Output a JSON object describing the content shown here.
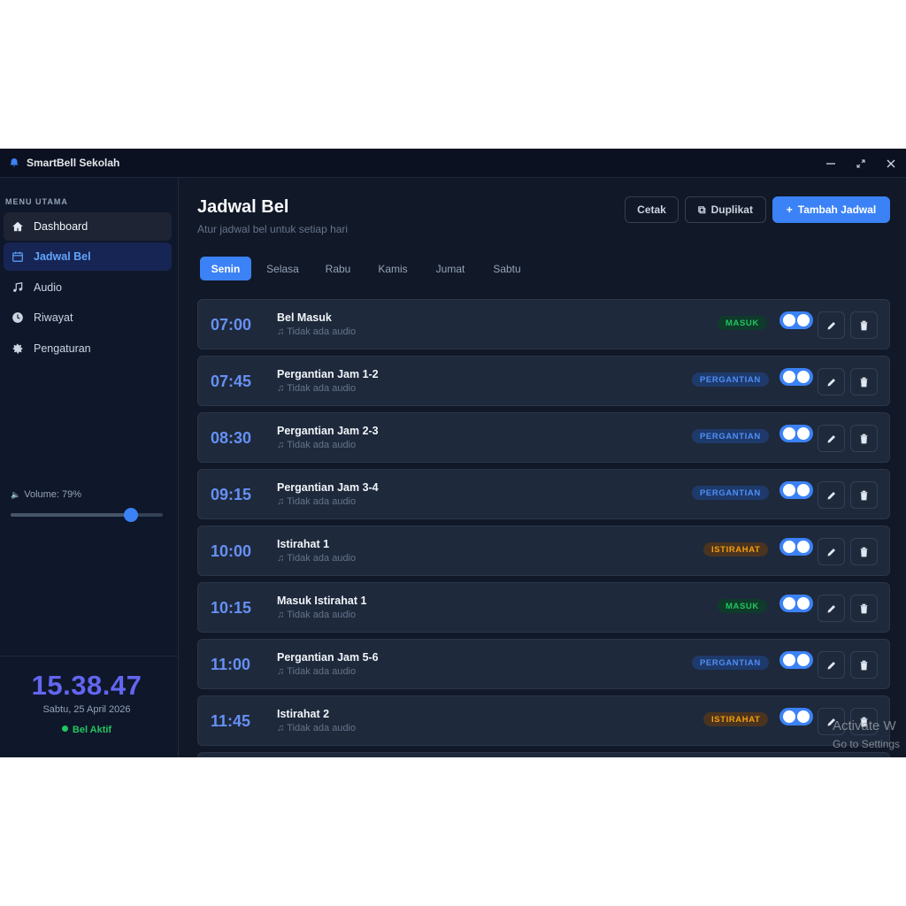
{
  "app": {
    "title": "SmartBell Sekolah"
  },
  "sidebar": {
    "heading": "MENU UTAMA",
    "items": [
      {
        "label": "Dashboard",
        "icon": "home-icon"
      },
      {
        "label": "Jadwal Bel",
        "icon": "calendar-icon"
      },
      {
        "label": "Audio",
        "icon": "music-icon"
      },
      {
        "label": "Riwayat",
        "icon": "clock-icon"
      },
      {
        "label": "Pengaturan",
        "icon": "gear-icon"
      }
    ],
    "volume_label": "Volume: 79%",
    "volume_level": 0.79,
    "clock": "15.38.47",
    "date": "Sabtu, 25 April 2026",
    "status": "Bel Aktif"
  },
  "main": {
    "title": "Jadwal Bel",
    "subtitle": "Atur jadwal bel untuk setiap hari",
    "buttons": {
      "print": "Cetak",
      "duplicate": "Duplikat",
      "add": "Tambah Jadwal"
    },
    "tabs": [
      "Senin",
      "Selasa",
      "Rabu",
      "Kamis",
      "Jumat",
      "Sabtu"
    ],
    "schedule": [
      {
        "time": "07:00",
        "name": "Bel Masuk",
        "audio": "Tidak ada audio",
        "badge": "MASUK",
        "type": "masuk",
        "enabled": true
      },
      {
        "time": "07:45",
        "name": "Pergantian Jam 1-2",
        "audio": "Tidak ada audio",
        "badge": "PERGANTIAN",
        "type": "pergantian",
        "enabled": true
      },
      {
        "time": "08:30",
        "name": "Pergantian Jam 2-3",
        "audio": "Tidak ada audio",
        "badge": "PERGANTIAN",
        "type": "pergantian",
        "enabled": true
      },
      {
        "time": "09:15",
        "name": "Pergantian Jam 3-4",
        "audio": "Tidak ada audio",
        "badge": "PERGANTIAN",
        "type": "pergantian",
        "enabled": true
      },
      {
        "time": "10:00",
        "name": "Istirahat 1",
        "audio": "Tidak ada audio",
        "badge": "ISTIRAHAT",
        "type": "istirahat",
        "enabled": true
      },
      {
        "time": "10:15",
        "name": "Masuk Istirahat 1",
        "audio": "Tidak ada audio",
        "badge": "MASUK",
        "type": "masuk",
        "enabled": true
      },
      {
        "time": "11:00",
        "name": "Pergantian Jam 5-6",
        "audio": "Tidak ada audio",
        "badge": "PERGANTIAN",
        "type": "pergantian",
        "enabled": true
      },
      {
        "time": "11:45",
        "name": "Istirahat 2",
        "audio": "Tidak ada audio",
        "badge": "ISTIRAHAT",
        "type": "istirahat",
        "enabled": true
      }
    ]
  },
  "watermark": {
    "line1": "Activate W",
    "line2": "Go to Settings"
  },
  "colors": {
    "accent": "#3b82f6",
    "clock": "#6366f1",
    "success": "#22c55e",
    "warning": "#f59e0b"
  }
}
